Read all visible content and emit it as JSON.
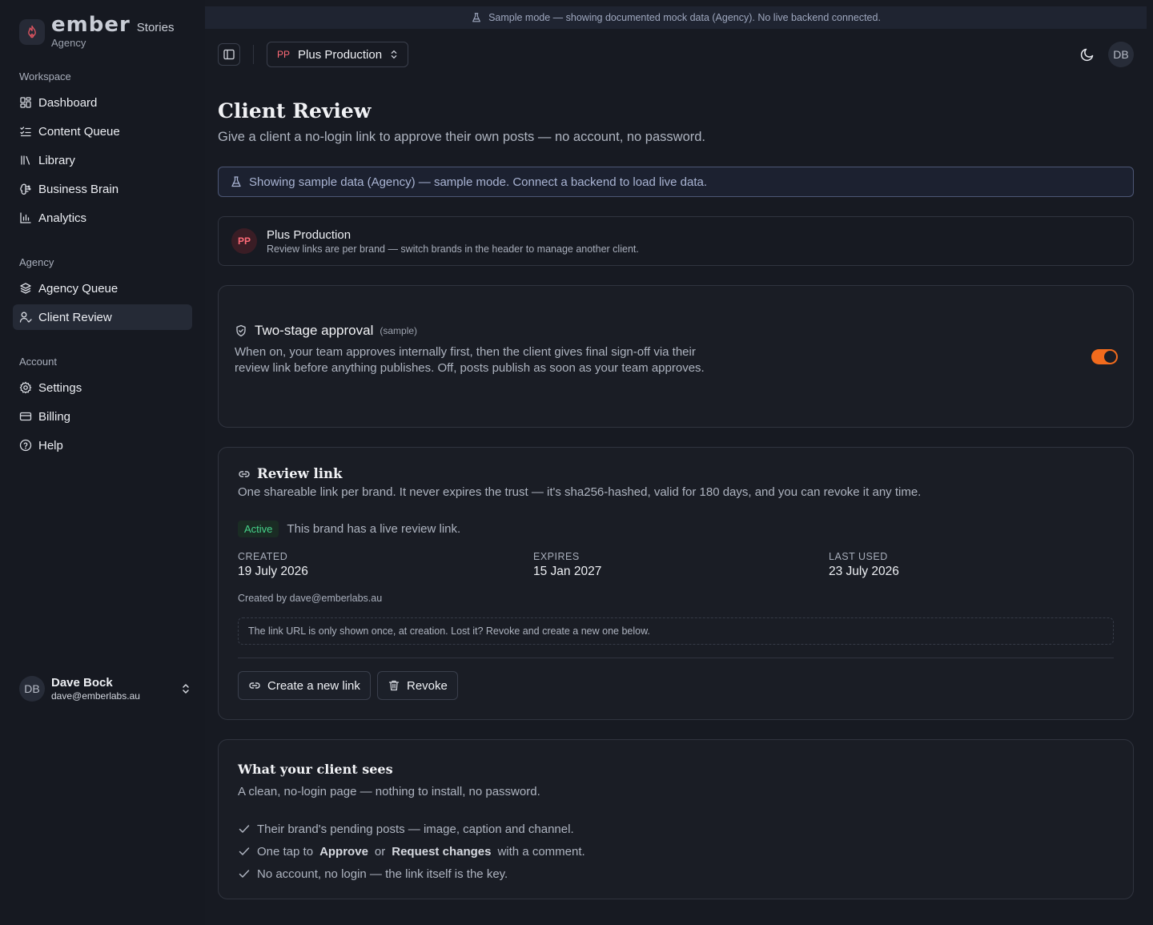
{
  "app": {
    "brand_word": "ember",
    "brand_suffix": "Stories",
    "brand_sub": "Agency"
  },
  "sidebar": {
    "sections": [
      {
        "label": "Workspace"
      },
      {
        "label": "Agency"
      },
      {
        "label": "Account"
      }
    ],
    "items": [
      {
        "label": "Dashboard",
        "icon": "dashboard-icon"
      },
      {
        "label": "Content Queue",
        "icon": "list-checks-icon"
      },
      {
        "label": "Library",
        "icon": "library-icon"
      },
      {
        "label": "Business Brain",
        "icon": "brain-icon"
      },
      {
        "label": "Analytics",
        "icon": "bar-chart-icon"
      },
      {
        "label": "Agency Queue",
        "icon": "layers-icon"
      },
      {
        "label": "Client Review",
        "icon": "user-check-icon",
        "active": true
      },
      {
        "label": "Settings",
        "icon": "gear-icon"
      },
      {
        "label": "Billing",
        "icon": "credit-card-icon"
      },
      {
        "label": "Help",
        "icon": "help-circle-icon"
      }
    ],
    "user": {
      "initials": "DB",
      "name": "Dave Bock",
      "email": "dave@emberlabs.au"
    }
  },
  "banner": {
    "text": "Sample mode — showing documented mock data (Agency). No live backend connected."
  },
  "header": {
    "brand_initials": "PP",
    "brand_name": "Plus Production",
    "avatar": "DB"
  },
  "page": {
    "title": "Client Review",
    "subtitle": "Give a client a no-login link to approve their own posts — no account, no password.",
    "notice": "Showing sample data (Agency) — sample mode. Connect a backend to load live data."
  },
  "brand_card": {
    "initials": "PP",
    "title": "Plus Production",
    "subtitle": "Review links are per brand — switch brands in the header to manage another client."
  },
  "approval": {
    "title": "Two-stage approval",
    "tag": "(sample)",
    "description": "When on, your team approves internally first, then the client gives final sign-off via their review link before anything publishes. Off, posts publish as soon as your team approves.",
    "enabled": true
  },
  "review_link": {
    "title": "Review link",
    "description": "One shareable link per brand. It never expires the trust — it's sha256-hashed, valid for 180 days, and you can revoke it any time.",
    "status_badge": "Active",
    "status_text": "This brand has a live review link.",
    "created_label": "CREATED",
    "created_value": "19 July 2026",
    "expires_label": "EXPIRES",
    "expires_value": "15 Jan 2027",
    "last_used_label": "LAST USED",
    "last_used_value": "23 July 2026",
    "created_by": "Created by dave@emberlabs.au",
    "url_note": "The link URL is only shown once, at creation. Lost it? Revoke and create a new one below.",
    "create_button": "Create a new link",
    "revoke_button": "Revoke"
  },
  "client_sees": {
    "title": "What your client sees",
    "subtitle": "A clean, no-login page — nothing to install, no password.",
    "item1": "Their brand's pending posts — image, caption and channel.",
    "item2_pre": "One tap to",
    "item2_approve": "Approve",
    "item2_or": "or",
    "item2_request": "Request changes",
    "item2_post": "with a comment.",
    "item3": "No account, no login — the link itself is the key."
  },
  "colors": {
    "accent": "#f26b1d",
    "success": "#46d38a",
    "brand_pink": "#ff6b78"
  }
}
